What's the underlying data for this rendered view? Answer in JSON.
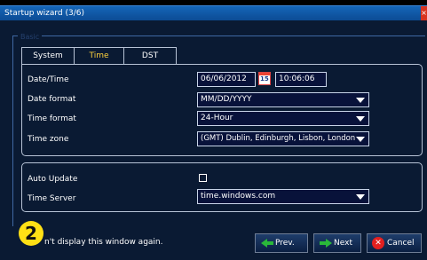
{
  "window": {
    "title": "Startup wizard (3/6)",
    "close_glyph": "×"
  },
  "group": {
    "label": "Basic"
  },
  "tabs": [
    {
      "label": "System",
      "active": false
    },
    {
      "label": "Time",
      "active": true
    },
    {
      "label": "DST",
      "active": false
    }
  ],
  "fields": {
    "date_time": {
      "label": "Date/Time",
      "date": "06/06/2012",
      "time": "10:06:06",
      "calendar_day": "15"
    },
    "date_format": {
      "label": "Date format",
      "value": "MM/DD/YYYY"
    },
    "time_format": {
      "label": "Time format",
      "value": "24-Hour"
    },
    "time_zone": {
      "label": "Time zone",
      "value": "(GMT) Dublin, Edinburgh, Lisbon, London"
    },
    "auto_update": {
      "label": "Auto Update",
      "checked": false
    },
    "time_server": {
      "label": "Time Server",
      "value": "time.windows.com"
    }
  },
  "footer": {
    "badge": "2",
    "dont_show_text": "n't display this window again.",
    "prev_label": "Prev.",
    "next_label": "Next",
    "cancel_label": "Cancel"
  },
  "colors": {
    "titlebar": "#0c4b94",
    "background": "#0a1a33",
    "active_tab_text": "#ffd23c",
    "badge": "#ffe015",
    "arrow_green": "#2ab83a",
    "cancel_red": "#e32020"
  }
}
